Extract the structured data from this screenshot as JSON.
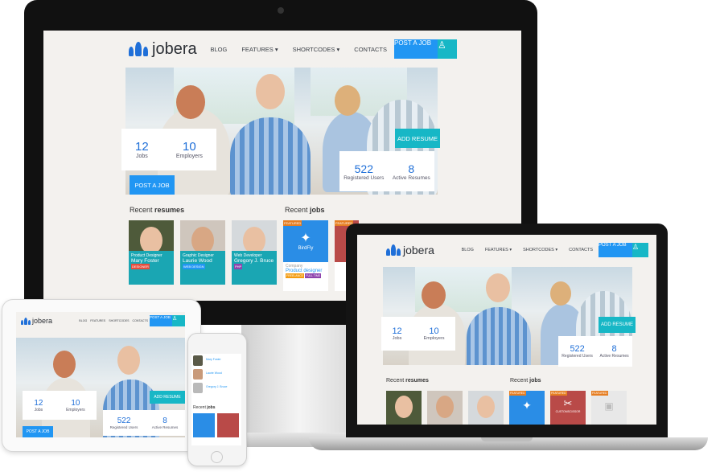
{
  "brand": {
    "name": "jobera",
    "accent": "#2196f3",
    "teal": "#17b7c6",
    "logo_blue": "#1f6fd8"
  },
  "nav": {
    "items": [
      "BLOG",
      "FEATURES",
      "SHORTCODES",
      "CONTACTS"
    ],
    "post_job": "POST A JOB",
    "user_icon": "user-icon"
  },
  "hero": {
    "jobs_count": "12",
    "jobs_label": "Jobs",
    "employers_count": "10",
    "employers_label": "Employers",
    "post_job": "POST A JOB",
    "add_resume": "ADD RESUME",
    "registered_count": "522",
    "registered_label": "Registered Users",
    "active_count": "8",
    "active_label": "Active Resumes"
  },
  "sections": {
    "recent": "Recent",
    "resumes": "resumes",
    "jobs": "jobs"
  },
  "resumes": [
    {
      "role": "Product Designer",
      "name": "Mary Foster",
      "tag": "DESIGNER",
      "meta": "5 months ago in San Francisco"
    },
    {
      "role": "Graphic Designer",
      "name": "Laurie Wood",
      "tag": "WEB DESIGN",
      "meta": "5 months ago in New York"
    },
    {
      "role": "Web Developer",
      "name": "Gregory J. Bruce",
      "tag": "PHP",
      "meta": "5 months ago in London, UK"
    }
  ],
  "jobs": [
    {
      "badge": "FEATURED",
      "brand": "BirdFly",
      "company": "Company",
      "title": "Product designer",
      "tags": [
        "FREELANCE",
        "FULL TIME"
      ],
      "meta": "5 months ago by BirdFly"
    },
    {
      "badge": "FEATURED",
      "brand": "CUSTOMSCISSOR",
      "title": "Info",
      "tags": [
        "FREELANCE"
      ]
    },
    {
      "badge": "FEATURED"
    }
  ],
  "menu_nav_abbrev": [
    "BLOG",
    "FEATURES",
    "SHORTCODES",
    "CONTACTS"
  ]
}
